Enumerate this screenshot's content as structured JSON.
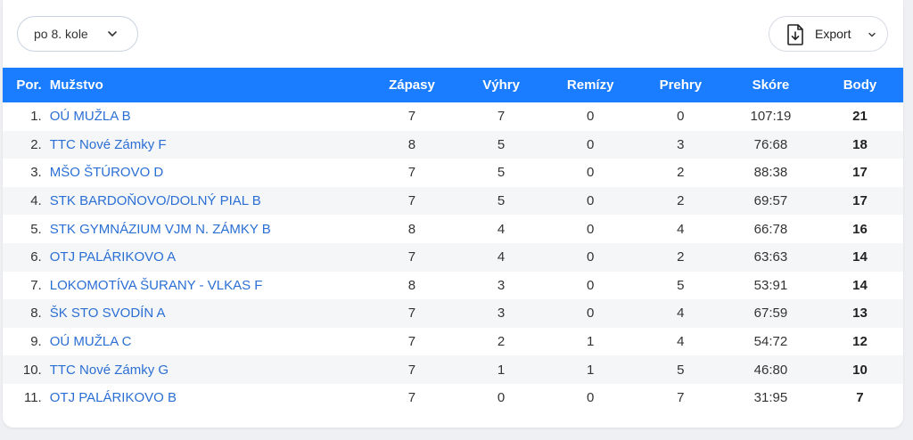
{
  "round_select": {
    "label": "po 8. kole"
  },
  "export": {
    "label": "Export"
  },
  "table": {
    "headers": {
      "pos": "Por.",
      "team": "Mužstvo",
      "matches": "Zápasy",
      "wins": "Výhry",
      "draws": "Remízy",
      "losses": "Prehry",
      "score": "Skóre",
      "points": "Body"
    },
    "rows": [
      {
        "pos": "1.",
        "team": "OÚ MUŽLA B",
        "matches": "7",
        "wins": "7",
        "draws": "0",
        "losses": "0",
        "score": "107:19",
        "points": "21"
      },
      {
        "pos": "2.",
        "team": "TTC Nové Zámky F",
        "matches": "8",
        "wins": "5",
        "draws": "0",
        "losses": "3",
        "score": "76:68",
        "points": "18"
      },
      {
        "pos": "3.",
        "team": "MŠO ŠTÚROVO D",
        "matches": "7",
        "wins": "5",
        "draws": "0",
        "losses": "2",
        "score": "88:38",
        "points": "17"
      },
      {
        "pos": "4.",
        "team": "STK BARDOŇOVO/DOLNÝ PIAL B",
        "matches": "7",
        "wins": "5",
        "draws": "0",
        "losses": "2",
        "score": "69:57",
        "points": "17"
      },
      {
        "pos": "5.",
        "team": "STK GYMNÁZIUM VJM N. ZÁMKY B",
        "matches": "8",
        "wins": "4",
        "draws": "0",
        "losses": "4",
        "score": "66:78",
        "points": "16"
      },
      {
        "pos": "6.",
        "team": "OTJ PALÁRIKOVO A",
        "matches": "7",
        "wins": "4",
        "draws": "0",
        "losses": "2",
        "score": "63:63",
        "points": "14"
      },
      {
        "pos": "7.",
        "team": "LOKOMOTÍVA ŠURANY - VLKAS F",
        "matches": "8",
        "wins": "3",
        "draws": "0",
        "losses": "5",
        "score": "53:91",
        "points": "14"
      },
      {
        "pos": "8.",
        "team": "ŠK STO SVODÍN A",
        "matches": "7",
        "wins": "3",
        "draws": "0",
        "losses": "4",
        "score": "67:59",
        "points": "13"
      },
      {
        "pos": "9.",
        "team": "OÚ MUŽLA C",
        "matches": "7",
        "wins": "2",
        "draws": "1",
        "losses": "4",
        "score": "54:72",
        "points": "12"
      },
      {
        "pos": "10.",
        "team": "TTC Nové Zámky G",
        "matches": "7",
        "wins": "1",
        "draws": "1",
        "losses": "5",
        "score": "46:80",
        "points": "10"
      },
      {
        "pos": "11.",
        "team": "OTJ PALÁRIKOVO B",
        "matches": "7",
        "wins": "0",
        "draws": "0",
        "losses": "7",
        "score": "31:95",
        "points": "7"
      }
    ]
  },
  "icons": {
    "round_chevron": "chevron-down-icon",
    "export_file": "file-download-icon",
    "export_chevron": "chevron-down-icon"
  },
  "colors": {
    "header_bg": "#1a7cff",
    "link": "#2b6fd4",
    "stripe": "#f4f6f8"
  }
}
